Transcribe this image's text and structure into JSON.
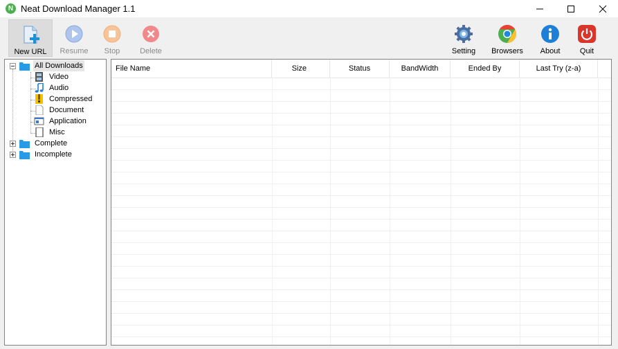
{
  "window": {
    "title": "Neat Download Manager 1.1",
    "app_icon_letter": "N"
  },
  "toolbar": {
    "new_url": "New URL",
    "resume": "Resume",
    "stop": "Stop",
    "delete": "Delete",
    "setting": "Setting",
    "browsers": "Browsers",
    "about": "About",
    "quit": "Quit"
  },
  "tree": {
    "all_downloads": "All Downloads",
    "children": [
      "Video",
      "Audio",
      "Compressed",
      "Document",
      "Application",
      "Misc"
    ],
    "complete": "Complete",
    "incomplete": "Incomplete"
  },
  "list": {
    "columns": [
      "File Name",
      "Size",
      "Status",
      "BandWidth",
      "Ended By",
      "Last Try (z-a)"
    ],
    "rows": []
  },
  "colors": {
    "accent_blue": "#1e90d6",
    "delete_red": "#e65b5b",
    "stop_orange": "#f5a15c",
    "quit_red": "#d9362b",
    "folder_blue": "#2b9ae6"
  }
}
